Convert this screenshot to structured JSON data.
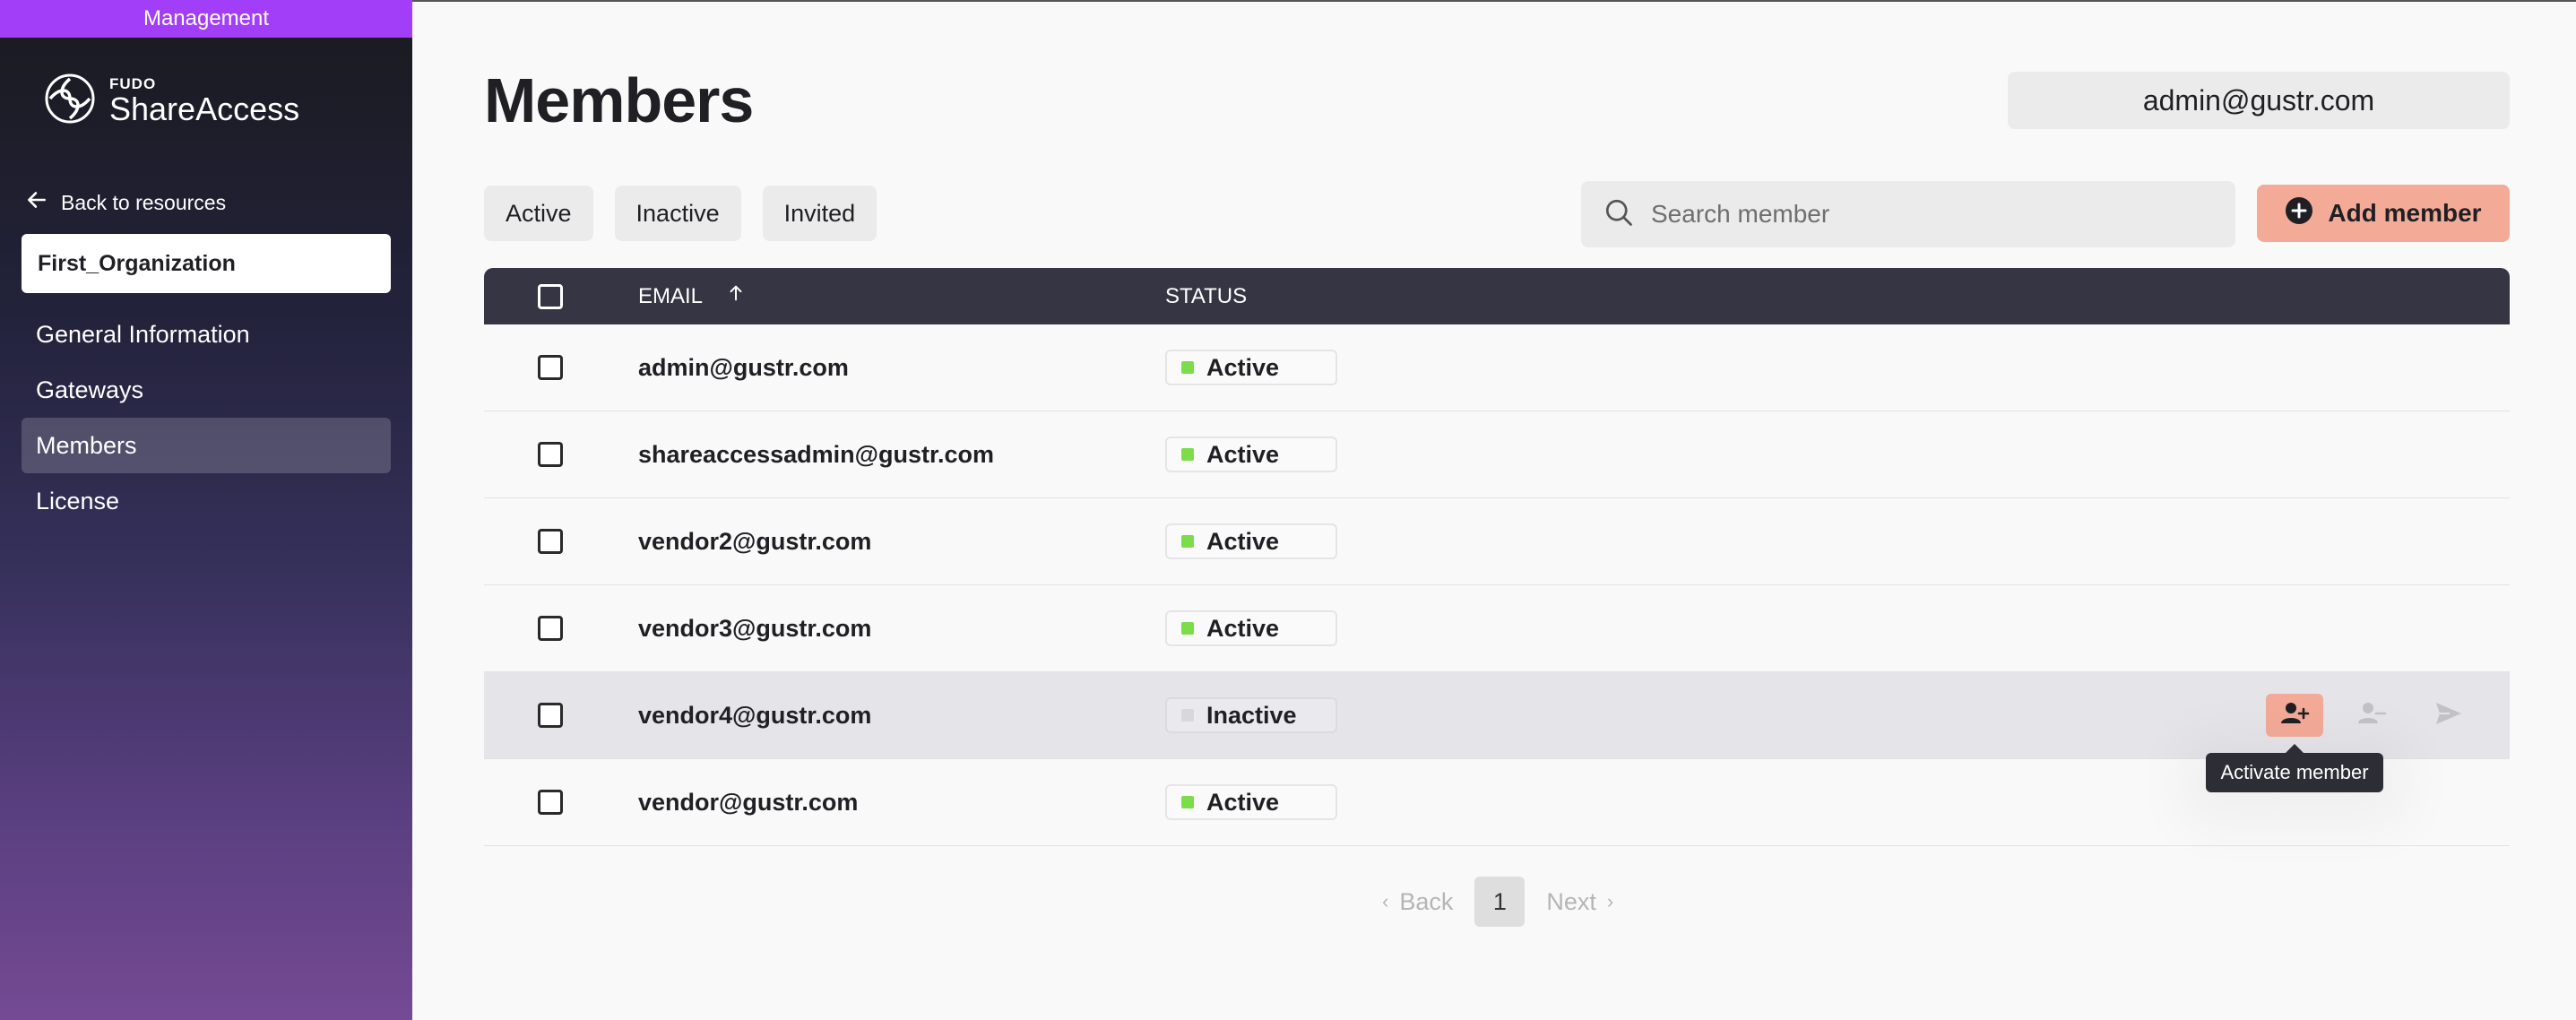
{
  "sidebar": {
    "management_label": "Management",
    "logo_small": "FUDO",
    "logo_big": "ShareAccess",
    "back_label": "Back to resources",
    "organization": "First_Organization",
    "nav": [
      {
        "label": "General Information",
        "active": false
      },
      {
        "label": "Gateways",
        "active": false
      },
      {
        "label": "Members",
        "active": true
      },
      {
        "label": "License",
        "active": false
      }
    ]
  },
  "header": {
    "title": "Members",
    "user": "admin@gustr.com"
  },
  "filters": [
    "Active",
    "Inactive",
    "Invited"
  ],
  "search": {
    "placeholder": "Search member"
  },
  "add_button": "Add member",
  "table": {
    "columns": {
      "email": "EMAIL",
      "status": "STATUS"
    },
    "rows": [
      {
        "email": "admin@gustr.com",
        "status": "Active"
      },
      {
        "email": "shareaccessadmin@gustr.com",
        "status": "Active"
      },
      {
        "email": "vendor2@gustr.com",
        "status": "Active"
      },
      {
        "email": "vendor3@gustr.com",
        "status": "Active"
      },
      {
        "email": "vendor4@gustr.com",
        "status": "Inactive"
      },
      {
        "email": "vendor@gustr.com",
        "status": "Active"
      }
    ]
  },
  "tooltip": "Activate member",
  "pagination": {
    "back": "Back",
    "page": "1",
    "next": "Next"
  },
  "colors": {
    "active_dot": "#7ddc4a",
    "inactive_dot": "#d8d8dc",
    "accent": "#f3ab98",
    "management": "#a23ef7"
  },
  "icons": {
    "logo": "fudo-logo-icon",
    "back": "arrow-left-icon",
    "search": "search-icon",
    "add": "plus-circle-icon",
    "sort": "arrow-up-icon",
    "activate": "user-plus-icon",
    "deactivate": "user-minus-icon",
    "invite": "send-icon"
  }
}
